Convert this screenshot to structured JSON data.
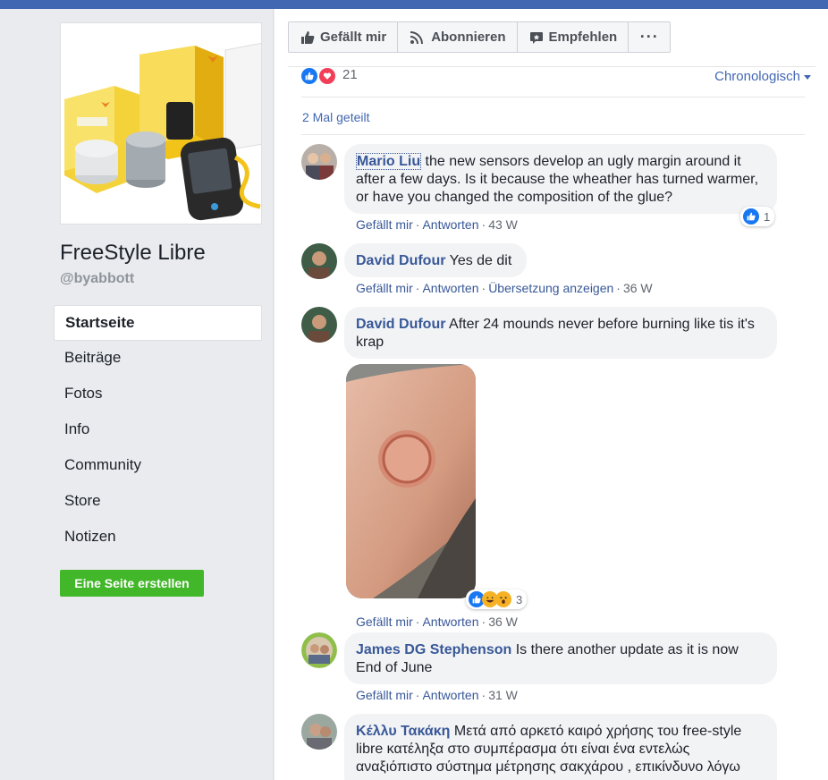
{
  "page": {
    "name": "FreeStyle Libre",
    "handle": "@byabbott"
  },
  "nav": {
    "items": [
      {
        "label": "Startseite"
      },
      {
        "label": "Beiträge"
      },
      {
        "label": "Fotos"
      },
      {
        "label": "Info"
      },
      {
        "label": "Community"
      },
      {
        "label": "Store"
      },
      {
        "label": "Notizen"
      }
    ],
    "create_label": "Eine Seite erstellen"
  },
  "actions": {
    "like": "Gefällt mir",
    "follow": "Abonnieren",
    "recommend": "Empfehlen",
    "more": "···"
  },
  "post": {
    "reaction_count": "21",
    "sort_label": "Chronologisch",
    "shared_label": "2 Mal geteilt"
  },
  "comments": [
    {
      "author": "Mario Liu",
      "text": " the new sensors develop an ugly margin around it after a few days. Is it because the wheather has turned warmer, or have you changed the composition of the glue?",
      "like": "Gefällt mir",
      "reply": "Antworten",
      "time": "43 W",
      "reaction_count": "1"
    },
    {
      "author": "David Dufour",
      "text": " Yes de dit",
      "like": "Gefällt mir",
      "reply": "Antworten",
      "translate": "Übersetzung anzeigen",
      "time": "36 W"
    },
    {
      "author": "David Dufour",
      "text": " After 24 mounds never before burning like tis it's krap",
      "like": "Gefällt mir",
      "reply": "Antworten",
      "time": "36 W",
      "reaction_count": "3"
    },
    {
      "author": "James DG Stephenson",
      "text": " Is there another update as it is now End of June",
      "like": "Gefällt mir",
      "reply": "Antworten",
      "time": "31 W"
    },
    {
      "author": "Κέλλυ Τακάκη",
      "text": " Μετά από αρκετό καιρό χρήσης του free-style libre κατέληξα στο συμπέρασμα ότι είναι ένα εντελώς αναξιόπιστο σύστημα μέτρησης σακχάρου , επικίνδυνο λόγω"
    }
  ],
  "colors": {
    "brand_blue": "#4267b2",
    "link_blue": "#385898",
    "create_green": "#42b72a",
    "bubble_bg": "#f2f3f5"
  }
}
